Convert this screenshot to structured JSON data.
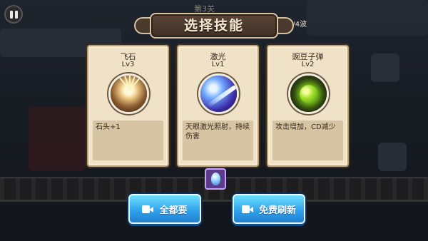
{
  "hud": {
    "wave_header": "第3关",
    "wave_count": "第1/4波"
  },
  "title": "选择技能",
  "cards": [
    {
      "name": "飞石",
      "level": "Lv3",
      "description": "石头+1",
      "icon": "flying-stone-icon"
    },
    {
      "name": "激光",
      "level": "Lv1",
      "description": "天眼激光照射，持续伤害",
      "icon": "laser-icon"
    },
    {
      "name": "豌豆子弹",
      "level": "Lv2",
      "description": "攻击增加，CD减少",
      "icon": "pea-bullet-icon"
    }
  ],
  "buttons": {
    "take_all": "全都要",
    "free_refresh": "免费刷新"
  },
  "colors": {
    "card_bg": "#efe2c6",
    "button_blue": "#31a4ec",
    "banner_brown": "#4a3a2e"
  }
}
